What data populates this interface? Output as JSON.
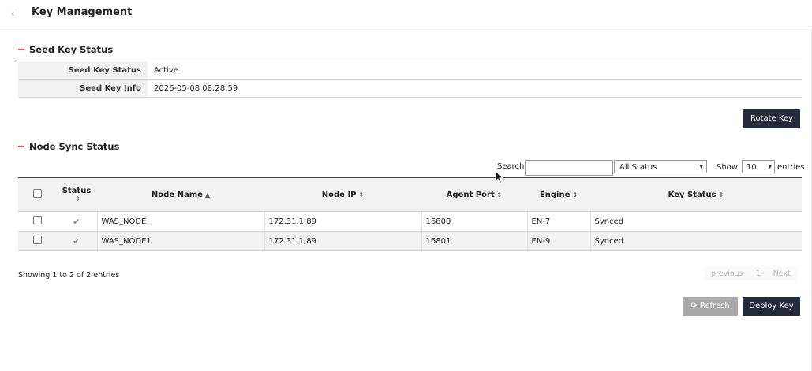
{
  "header": {
    "title": "Key Management",
    "back_icon": "chevron-left-icon"
  },
  "seed_section": {
    "title": "Seed Key Status",
    "rows": [
      {
        "label": "Seed Key Status",
        "value": "Active"
      },
      {
        "label": "Seed Key Info",
        "value": "2026-05-08 08:28:59"
      }
    ],
    "rotate_button": "Rotate Key"
  },
  "node_section": {
    "title": "Node Sync Status",
    "search_label": "Search",
    "search_value": "",
    "status_filter": "All Status",
    "show_label": "Show",
    "page_size": "10",
    "entries_label": "entries",
    "columns": [
      "Status",
      "Node Name",
      "Node IP",
      "Agent Port",
      "Engine",
      "Key Status"
    ],
    "rows": [
      {
        "name": "WAS_NODE",
        "ip": "172.31.1.89",
        "port": "16800",
        "engine": "EN-7",
        "key_status": "Synced"
      },
      {
        "name": "WAS_NODE1",
        "ip": "172.31.1.89",
        "port": "16801",
        "engine": "EN-9",
        "key_status": "Synced"
      }
    ],
    "showing_text": "Showing 1 to 2 of 2 entries",
    "pager": {
      "previous": "previous",
      "page": "1",
      "next": "Next"
    },
    "refresh_button": "Refresh",
    "deploy_button": "Deploy Key"
  }
}
